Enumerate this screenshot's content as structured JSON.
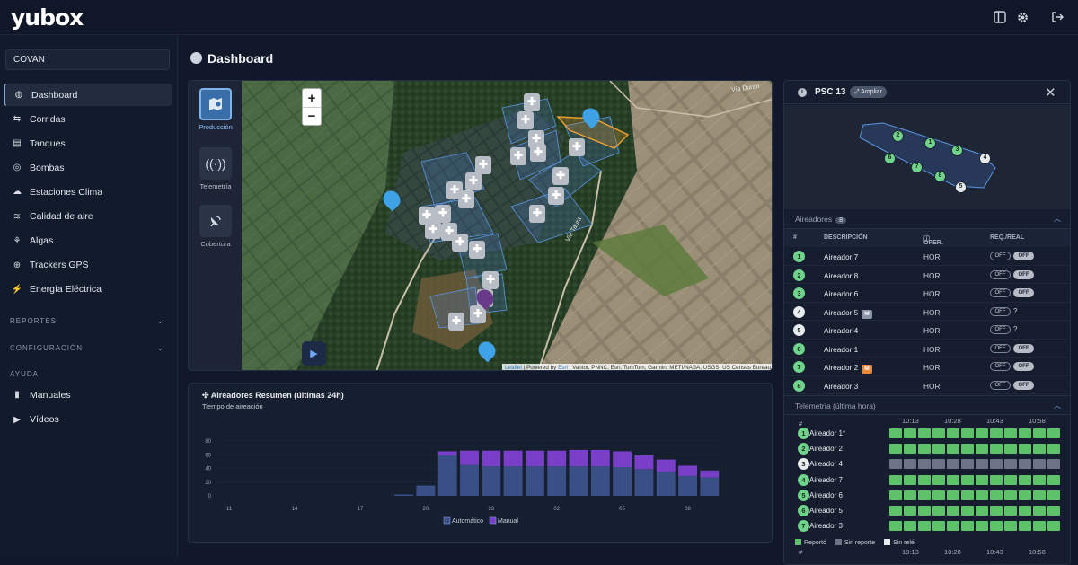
{
  "brand": {
    "logo_text": "yubox"
  },
  "topbar": {
    "icons": [
      "sidebar-toggle-icon",
      "gear-icon",
      "logout-icon"
    ]
  },
  "sidebar": {
    "org": "COVAN",
    "items": [
      {
        "label": "Dashboard",
        "icon": "dashboard-icon",
        "active": true
      },
      {
        "label": "Corridas",
        "icon": "route-icon"
      },
      {
        "label": "Tanques",
        "icon": "tank-icon"
      },
      {
        "label": "Bombas",
        "icon": "pump-icon"
      },
      {
        "label": "Estaciones Clima",
        "icon": "weather-icon"
      },
      {
        "label": "Calidad de aire",
        "icon": "air-quality-icon"
      },
      {
        "label": "Algas",
        "icon": "algae-icon"
      },
      {
        "label": "Trackers GPS",
        "icon": "gps-icon"
      },
      {
        "label": "Energía Eléctrica",
        "icon": "bolt-icon"
      }
    ],
    "sections": {
      "reportes": "REPORTES",
      "configuracion": "CONFIGURACIÓN",
      "ayuda": "AYUDA"
    },
    "help_items": [
      {
        "label": "Manuales",
        "icon": "book-icon"
      },
      {
        "label": "Vídeos",
        "icon": "video-icon"
      }
    ]
  },
  "page": {
    "title": "Dashboard"
  },
  "map": {
    "tabs": [
      {
        "label": "Producción",
        "selected": true
      },
      {
        "label": "Telemetría"
      },
      {
        "label": "Cobertura"
      }
    ],
    "zoom_in": "+",
    "zoom_out": "−",
    "road_labels": [
      "Vía Taura",
      "Vía Duran"
    ],
    "attribution": {
      "leaflet": "Leaflet",
      "powered": " | Powered by ",
      "esri": "Esri",
      "rest": " | Vantor, PNNC, Esri, TomTom, Garmin, METI/NASA, USGS, US Census Bureau"
    }
  },
  "chart": {
    "title": "Aireadores Resumen (últimas 24h)",
    "subtitle": "Tiempo de aireación"
  },
  "chart_data": {
    "type": "bar",
    "stacked": true,
    "categories": [
      "11",
      "12",
      "13",
      "14",
      "15",
      "16",
      "17",
      "18",
      "19",
      "20",
      "21",
      "22",
      "23",
      "00",
      "01",
      "02",
      "03",
      "04",
      "05",
      "06",
      "07",
      "08",
      "09"
    ],
    "tick_labels": [
      "11",
      "14",
      "17",
      "20",
      "23",
      "02",
      "05",
      "08"
    ],
    "series": [
      {
        "name": "Automático",
        "color": "#3a4f86",
        "values": [
          0,
          0,
          0,
          0,
          0,
          0,
          0,
          0,
          2,
          15,
          59,
          45,
          43,
          43,
          43,
          43,
          43,
          43,
          42,
          39,
          35,
          29,
          27
        ]
      },
      {
        "name": "Manual",
        "color": "#7a3fc8",
        "values": [
          0,
          0,
          0,
          0,
          0,
          0,
          0,
          0,
          0,
          0,
          6,
          21,
          23,
          23,
          23,
          23,
          24,
          24,
          23,
          20,
          18,
          15,
          10
        ]
      }
    ],
    "ylim": [
      0,
      80
    ],
    "yticks": [
      0,
      20,
      40,
      60,
      80
    ],
    "grid": true,
    "legend": "bottom"
  },
  "panel": {
    "title": "PSC 13",
    "expand_label": "Ampliar",
    "aireadores_label": "Aireadores",
    "aireadores_count": "8",
    "columns": [
      "#",
      "DESCRIPCIÓN",
      "OPER.",
      "REQ./REAL"
    ],
    "rows": [
      {
        "num": "1",
        "desc": "Aireador 7",
        "tag": "",
        "op": "HOR",
        "req": "OFF",
        "real": "OFF",
        "color": "#6fd38b"
      },
      {
        "num": "2",
        "desc": "Aireador 8",
        "tag": "",
        "op": "HOR",
        "req": "OFF",
        "real": "OFF",
        "color": "#6fd38b"
      },
      {
        "num": "3",
        "desc": "Aireador 6",
        "tag": "",
        "op": "HOR",
        "req": "OFF",
        "real": "OFF",
        "color": "#6fd38b"
      },
      {
        "num": "4",
        "desc": "Aireador 5",
        "tag": "M",
        "tagcolor": "#8b94a6",
        "op": "HOR",
        "req": "OFF",
        "real": "?",
        "color": "#e8ebf0"
      },
      {
        "num": "5",
        "desc": "Aireador 4",
        "tag": "",
        "op": "HOR",
        "req": "OFF",
        "real": "?",
        "color": "#e8ebf0"
      },
      {
        "num": "6",
        "desc": "Aireador 1",
        "tag": "",
        "op": "HOR",
        "req": "OFF",
        "real": "OFF",
        "color": "#6fd38b"
      },
      {
        "num": "7",
        "desc": "Aireador 2",
        "tag": "M",
        "tagcolor": "#e88a3a",
        "op": "HOR",
        "req": "OFF",
        "real": "OFF",
        "color": "#6fd38b"
      },
      {
        "num": "8",
        "desc": "Aireador 3",
        "tag": "",
        "op": "HOR",
        "req": "OFF",
        "real": "OFF",
        "color": "#6fd38b"
      }
    ],
    "telemetry_label": "Telemetría (última hora)",
    "telemetry_hash": "#",
    "telemetry_times": [
      "10:13",
      "10:28",
      "10:43",
      "10:58"
    ],
    "telemetry_rows": [
      {
        "num": "1",
        "label": "Aireador 1*",
        "status": "green"
      },
      {
        "num": "2",
        "label": "Aireador 2",
        "status": "green"
      },
      {
        "num": "3",
        "label": "Aireador 4",
        "status": "gray"
      },
      {
        "num": "4",
        "label": "Aireador 7",
        "status": "green"
      },
      {
        "num": "5",
        "label": "Aireador 6",
        "status": "green"
      },
      {
        "num": "6",
        "label": "Aireador 5",
        "status": "green"
      },
      {
        "num": "7",
        "label": "Aireador 3",
        "status": "green"
      }
    ],
    "legend": {
      "reporto": "Reportó",
      "sin_reporte": "Sin reporte",
      "sin_rele": "Sin relé"
    },
    "colors": {
      "green": "#5ec26a",
      "gray": "#6b7384",
      "white": "#e8ebf0"
    }
  }
}
